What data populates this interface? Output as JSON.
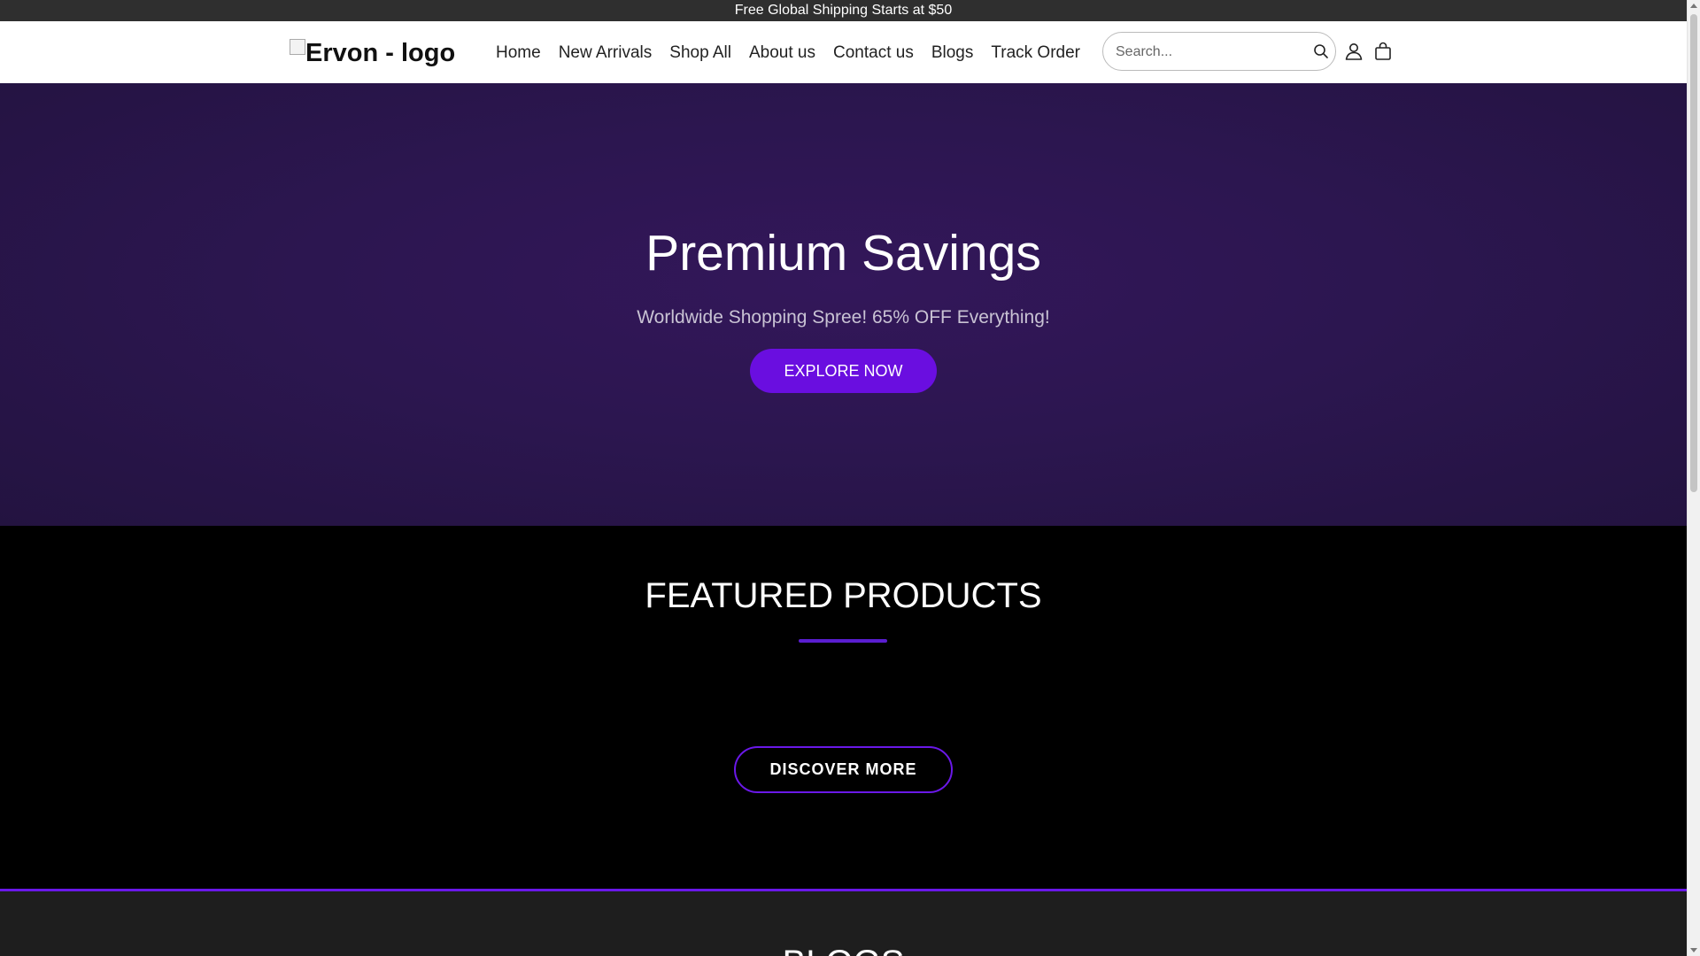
{
  "announcement": "Free Global Shipping Starts at $50",
  "header": {
    "logo_alt": "Ervon - logo",
    "nav": [
      "Home",
      "New Arrivals",
      "Shop All",
      "About us",
      "Contact us",
      "Blogs",
      "Track Order"
    ],
    "search_placeholder": "Search...",
    "icons": {
      "search": "search-icon",
      "account": "user-icon",
      "cart": "shopping-bag-icon"
    }
  },
  "hero": {
    "title": "Premium Savings",
    "subtitle": "Worldwide Shopping Spree! 65% OFF Everything!",
    "button": "EXPLORE NOW"
  },
  "featured": {
    "title": "FEATURED PRODUCTS",
    "button": "DISCOVER MORE"
  },
  "blogs": {
    "title": "BLOGS"
  },
  "colors": {
    "accent": "#6a0ee0",
    "hero_bg": "#2c1650",
    "announcement_bg": "#2f2f2f",
    "blogs_bg": "#1e1e1e"
  }
}
